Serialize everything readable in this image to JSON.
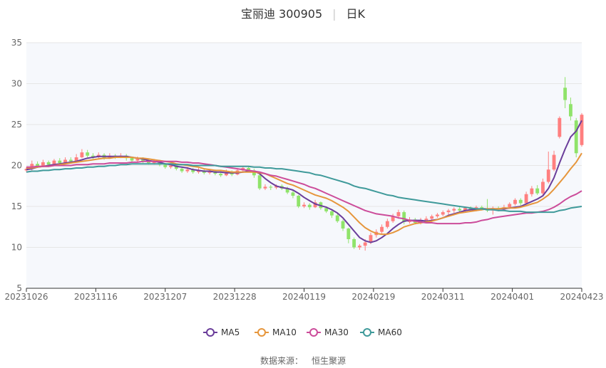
{
  "header": {
    "title": "宝丽迪 300905",
    "period": "日K"
  },
  "source": {
    "label": "数据来源：",
    "provider": "恒生聚源"
  },
  "colors": {
    "up": "#ff7f7f",
    "down": "#8fe36a",
    "ma5": "#6a3d9a",
    "ma10": "#e6963c",
    "ma30": "#cc4c9a",
    "ma60": "#3f9a9a",
    "grid": "#e6e6e6",
    "plot_bg": "#f6f8fc"
  },
  "chart_data": {
    "type": "candlestick",
    "ylim": [
      5,
      35
    ],
    "yticks": [
      5,
      10,
      15,
      20,
      25,
      30,
      35
    ],
    "xticks": [
      "20231026",
      "20231116",
      "20231207",
      "20231228",
      "20240119",
      "20240219",
      "20240311",
      "20240401",
      "20240423"
    ],
    "legend": [
      "MA5",
      "MA10",
      "MA30",
      "MA60"
    ],
    "legend_position": "bottom",
    "candles": [
      [
        19.4,
        19.6,
        19.2,
        19.8
      ],
      [
        19.6,
        20.2,
        19.4,
        20.6
      ],
      [
        20.2,
        19.9,
        19.7,
        20.5
      ],
      [
        19.9,
        20.4,
        19.8,
        20.7
      ],
      [
        20.4,
        20.1,
        19.9,
        20.6
      ],
      [
        20.1,
        20.6,
        20.0,
        20.8
      ],
      [
        20.6,
        20.3,
        20.1,
        20.9
      ],
      [
        20.3,
        20.7,
        20.2,
        21.0
      ],
      [
        20.7,
        20.5,
        20.3,
        21.0
      ],
      [
        20.5,
        21.0,
        20.4,
        21.4
      ],
      [
        21.0,
        21.6,
        20.9,
        22.0
      ],
      [
        21.6,
        21.2,
        21.0,
        21.9
      ],
      [
        21.2,
        21.0,
        20.8,
        21.5
      ],
      [
        21.0,
        21.3,
        20.9,
        21.6
      ],
      [
        21.3,
        20.9,
        20.7,
        21.5
      ],
      [
        20.9,
        21.2,
        20.8,
        21.5
      ],
      [
        21.2,
        21.0,
        20.8,
        21.4
      ],
      [
        21.0,
        21.2,
        20.9,
        21.5
      ],
      [
        21.2,
        20.9,
        20.6,
        21.4
      ],
      [
        20.9,
        20.6,
        20.4,
        21.1
      ],
      [
        20.6,
        20.8,
        20.4,
        21.1
      ],
      [
        20.8,
        20.5,
        20.3,
        21.0
      ],
      [
        20.5,
        20.3,
        20.1,
        20.8
      ],
      [
        20.3,
        20.5,
        20.1,
        20.8
      ],
      [
        20.5,
        20.1,
        19.9,
        20.7
      ],
      [
        20.1,
        19.8,
        19.6,
        20.3
      ],
      [
        19.8,
        20.0,
        19.6,
        20.3
      ],
      [
        20.0,
        19.6,
        19.4,
        20.2
      ],
      [
        19.6,
        19.3,
        19.1,
        19.8
      ],
      [
        19.3,
        19.5,
        19.1,
        19.8
      ],
      [
        19.5,
        19.2,
        19.0,
        19.7
      ],
      [
        19.2,
        19.4,
        19.0,
        19.7
      ],
      [
        19.4,
        19.1,
        18.9,
        19.6
      ],
      [
        19.1,
        19.3,
        18.9,
        19.6
      ],
      [
        19.3,
        19.0,
        18.8,
        19.5
      ],
      [
        19.0,
        18.8,
        18.6,
        19.3
      ],
      [
        18.8,
        19.2,
        18.7,
        19.5
      ],
      [
        19.2,
        18.9,
        18.7,
        19.4
      ],
      [
        18.9,
        19.4,
        18.8,
        19.7
      ],
      [
        19.4,
        19.7,
        19.2,
        19.9
      ],
      [
        19.7,
        19.4,
        19.2,
        19.9
      ],
      [
        19.4,
        18.8,
        18.5,
        19.6
      ],
      [
        18.8,
        17.2,
        17.0,
        18.9
      ],
      [
        17.2,
        17.4,
        17.0,
        17.7
      ],
      [
        17.4,
        17.3,
        17.0,
        17.6
      ],
      [
        17.3,
        17.5,
        17.1,
        17.7
      ],
      [
        17.5,
        17.2,
        17.0,
        17.7
      ],
      [
        17.2,
        16.7,
        16.5,
        17.4
      ],
      [
        16.7,
        16.3,
        16.0,
        16.9
      ],
      [
        16.3,
        15.0,
        14.8,
        16.4
      ],
      [
        15.0,
        15.2,
        14.8,
        15.5
      ],
      [
        15.2,
        14.9,
        14.6,
        15.4
      ],
      [
        14.9,
        15.5,
        14.8,
        15.8
      ],
      [
        15.5,
        14.8,
        14.6,
        15.6
      ],
      [
        14.8,
        14.4,
        14.2,
        15.0
      ],
      [
        14.4,
        13.9,
        13.6,
        14.6
      ],
      [
        13.9,
        13.2,
        13.0,
        14.1
      ],
      [
        13.2,
        12.3,
        12.0,
        13.4
      ],
      [
        12.3,
        11.0,
        10.5,
        12.4
      ],
      [
        11.0,
        10.0,
        9.8,
        11.2
      ],
      [
        10.0,
        10.2,
        9.7,
        10.4
      ],
      [
        10.2,
        10.6,
        9.6,
        11.0
      ],
      [
        10.6,
        11.5,
        10.4,
        11.8
      ],
      [
        11.5,
        11.9,
        11.2,
        12.2
      ],
      [
        11.9,
        12.5,
        11.7,
        12.8
      ],
      [
        12.5,
        13.2,
        12.3,
        13.5
      ],
      [
        13.2,
        13.8,
        13.0,
        14.1
      ],
      [
        13.8,
        14.3,
        13.5,
        14.6
      ],
      [
        14.3,
        13.1,
        12.8,
        14.5
      ],
      [
        13.1,
        13.4,
        12.9,
        13.7
      ],
      [
        13.4,
        13.0,
        12.8,
        13.6
      ],
      [
        13.0,
        13.3,
        12.8,
        13.6
      ],
      [
        13.3,
        13.5,
        13.1,
        13.8
      ],
      [
        13.5,
        13.8,
        13.3,
        14.0
      ],
      [
        13.8,
        14.0,
        13.6,
        14.2
      ],
      [
        14.0,
        14.3,
        13.8,
        14.5
      ],
      [
        14.3,
        14.5,
        14.0,
        14.7
      ],
      [
        14.5,
        14.7,
        14.2,
        14.9
      ],
      [
        14.7,
        14.5,
        14.3,
        14.9
      ],
      [
        14.5,
        14.8,
        14.3,
        15.0
      ],
      [
        14.8,
        14.6,
        14.4,
        15.0
      ],
      [
        14.6,
        14.9,
        14.4,
        15.1
      ],
      [
        14.9,
        14.7,
        14.5,
        15.1
      ],
      [
        14.7,
        14.5,
        14.3,
        15.9
      ],
      [
        14.5,
        14.8,
        14.0,
        15.0
      ],
      [
        14.8,
        14.6,
        14.4,
        15.0
      ],
      [
        14.6,
        14.9,
        14.4,
        15.2
      ],
      [
        14.9,
        15.3,
        14.7,
        15.5
      ],
      [
        15.3,
        15.8,
        15.1,
        16.0
      ],
      [
        15.8,
        15.4,
        15.1,
        16.0
      ],
      [
        15.4,
        16.5,
        15.2,
        16.8
      ],
      [
        16.5,
        17.2,
        16.2,
        17.5
      ],
      [
        17.2,
        16.6,
        16.4,
        17.6
      ],
      [
        16.6,
        18.0,
        16.4,
        18.4
      ],
      [
        18.0,
        19.5,
        17.8,
        21.7
      ],
      [
        19.5,
        21.3,
        19.3,
        21.8
      ],
      [
        23.5,
        25.8,
        23.3,
        26.0
      ],
      [
        29.5,
        28.0,
        27.0,
        30.8
      ],
      [
        27.5,
        26.0,
        25.5,
        28.3
      ],
      [
        25.5,
        21.5,
        21.0,
        25.8
      ],
      [
        22.5,
        26.2,
        22.3,
        26.4
      ]
    ],
    "series": [
      {
        "name": "MA5",
        "values": [
          19.5,
          19.6,
          19.8,
          19.9,
          20.0,
          20.1,
          20.2,
          20.3,
          20.4,
          20.5,
          20.7,
          20.9,
          21.0,
          21.1,
          21.1,
          21.1,
          21.1,
          21.1,
          21.1,
          21.0,
          20.9,
          20.8,
          20.6,
          20.5,
          20.4,
          20.2,
          20.1,
          19.9,
          19.8,
          19.7,
          19.5,
          19.4,
          19.3,
          19.3,
          19.2,
          19.2,
          19.1,
          19.1,
          19.1,
          19.2,
          19.3,
          19.3,
          19.0,
          18.4,
          17.9,
          17.5,
          17.3,
          17.2,
          17.0,
          16.6,
          16.1,
          15.7,
          15.3,
          15.1,
          14.9,
          14.6,
          14.2,
          13.6,
          12.8,
          12.0,
          11.2,
          10.8,
          10.6,
          10.8,
          11.2,
          11.7,
          12.3,
          12.8,
          13.2,
          13.3,
          13.3,
          13.3,
          13.2,
          13.3,
          13.4,
          13.6,
          13.9,
          14.1,
          14.3,
          14.5,
          14.6,
          14.6,
          14.7,
          14.7,
          14.7,
          14.7,
          14.7,
          14.8,
          14.9,
          15.0,
          15.3,
          15.6,
          15.9,
          16.3,
          17.2,
          18.5,
          20.3,
          22.0,
          23.5,
          24.2,
          25.5
        ]
      },
      {
        "name": "MA10",
        "values": [
          19.7,
          19.7,
          19.8,
          19.9,
          19.9,
          20.0,
          20.1,
          20.2,
          20.3,
          20.4,
          20.5,
          20.6,
          20.7,
          20.8,
          20.9,
          20.9,
          21.0,
          21.0,
          21.0,
          21.0,
          20.9,
          20.9,
          20.8,
          20.7,
          20.6,
          20.5,
          20.4,
          20.2,
          20.1,
          20.0,
          19.9,
          19.8,
          19.6,
          19.5,
          19.4,
          19.4,
          19.3,
          19.2,
          19.2,
          19.2,
          19.2,
          19.2,
          19.1,
          19.0,
          18.7,
          18.4,
          18.1,
          17.8,
          17.6,
          17.3,
          17.0,
          16.7,
          16.4,
          16.2,
          16.0,
          15.7,
          15.3,
          14.9,
          14.4,
          13.7,
          13.0,
          12.4,
          12.0,
          11.7,
          11.6,
          11.6,
          11.8,
          12.1,
          12.5,
          12.7,
          12.9,
          13.0,
          13.1,
          13.2,
          13.4,
          13.6,
          13.8,
          14.0,
          14.2,
          14.3,
          14.4,
          14.5,
          14.6,
          14.7,
          14.7,
          14.7,
          14.8,
          14.8,
          14.8,
          14.9,
          15.1,
          15.3,
          15.5,
          15.9,
          16.4,
          17.1,
          17.9,
          18.7,
          19.6,
          20.4,
          21.5
        ]
      },
      {
        "name": "MA30",
        "values": [
          19.8,
          19.8,
          19.9,
          19.9,
          19.9,
          20.0,
          20.0,
          20.0,
          20.0,
          20.1,
          20.1,
          20.1,
          20.2,
          20.2,
          20.2,
          20.3,
          20.3,
          20.3,
          20.3,
          20.4,
          20.4,
          20.5,
          20.5,
          20.5,
          20.5,
          20.5,
          20.5,
          20.5,
          20.4,
          20.4,
          20.3,
          20.3,
          20.2,
          20.1,
          20.0,
          19.9,
          19.8,
          19.7,
          19.6,
          19.5,
          19.4,
          19.3,
          19.2,
          19.0,
          18.8,
          18.7,
          18.5,
          18.3,
          18.1,
          17.9,
          17.7,
          17.4,
          17.2,
          16.9,
          16.6,
          16.3,
          16.0,
          15.7,
          15.4,
          15.1,
          14.8,
          14.5,
          14.3,
          14.1,
          14.0,
          13.9,
          13.8,
          13.6,
          13.5,
          13.3,
          13.2,
          13.1,
          13.0,
          13.0,
          12.9,
          12.9,
          12.9,
          12.9,
          12.9,
          13.0,
          13.0,
          13.1,
          13.3,
          13.4,
          13.6,
          13.7,
          13.8,
          13.9,
          14.0,
          14.1,
          14.2,
          14.2,
          14.3,
          14.4,
          14.6,
          14.9,
          15.3,
          15.8,
          16.2,
          16.5,
          16.9
        ]
      },
      {
        "name": "MA60",
        "values": [
          19.2,
          19.3,
          19.3,
          19.4,
          19.4,
          19.5,
          19.5,
          19.6,
          19.6,
          19.7,
          19.7,
          19.8,
          19.8,
          19.9,
          19.9,
          20.0,
          20.0,
          20.1,
          20.1,
          20.2,
          20.2,
          20.2,
          20.2,
          20.2,
          20.2,
          20.2,
          20.2,
          20.1,
          20.1,
          20.1,
          20.0,
          20.0,
          20.0,
          20.0,
          20.0,
          19.9,
          19.9,
          19.9,
          19.9,
          19.9,
          19.9,
          19.8,
          19.8,
          19.7,
          19.7,
          19.6,
          19.6,
          19.5,
          19.4,
          19.3,
          19.2,
          19.1,
          18.9,
          18.8,
          18.6,
          18.4,
          18.2,
          18.0,
          17.8,
          17.5,
          17.3,
          17.2,
          17.0,
          16.8,
          16.6,
          16.4,
          16.3,
          16.1,
          16.0,
          15.9,
          15.8,
          15.7,
          15.6,
          15.5,
          15.4,
          15.3,
          15.2,
          15.1,
          15.0,
          14.9,
          14.8,
          14.7,
          14.7,
          14.6,
          14.6,
          14.5,
          14.5,
          14.4,
          14.4,
          14.4,
          14.3,
          14.3,
          14.3,
          14.3,
          14.3,
          14.3,
          14.5,
          14.6,
          14.8,
          14.9,
          15.0
        ]
      }
    ]
  }
}
